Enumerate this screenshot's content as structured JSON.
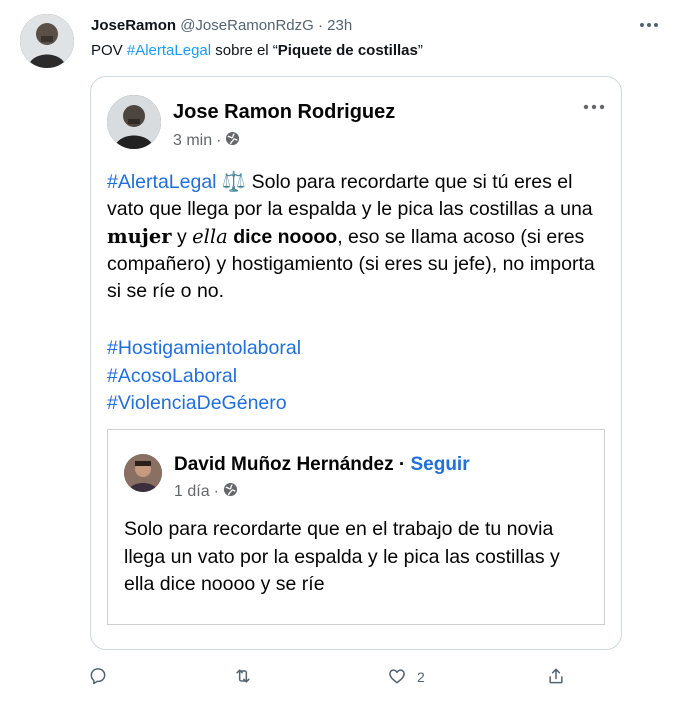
{
  "tweet": {
    "display_name": "JoseRamon",
    "handle": "@JoseRamonRdzG",
    "separator": "·",
    "time": "23h",
    "text_prefix": "POV ",
    "hashtag": "#AlertaLegal",
    "text_middle": " sobre el ",
    "quote_open": "“",
    "bold_phrase": "Piquete de costillas",
    "quote_close": "”"
  },
  "facebook_post": {
    "author": "Jose Ramon Rodriguez",
    "time": "3 min",
    "separator": "·",
    "hashtag": "#AlertaLegal",
    "emoji": "⚖️",
    "text_1": " Solo para recordarte que si tú eres el vato que llega por la espalda y le pica las costillas a una ",
    "word_mujer": "mujer",
    "text_2": " y ",
    "word_ella": "ella",
    "word_dice": " dice noooo",
    "text_3": ", eso se llama acoso (si eres compañero) y hostigamiento (si eres su jefe), no importa si se ríe o no.",
    "hashtags": [
      "#Hostigamientolaboral",
      "#AcosoLaboral",
      "#ViolenciaDeGénero"
    ]
  },
  "shared_post": {
    "author": "David Muñoz Hernández",
    "separator": "·",
    "follow_label": "Seguir",
    "time": "1 día",
    "text": "Solo para recordarte que en el trabajo de tu novia llega un vato por la espalda y le pica las costillas y ella dice noooo y se ríe"
  },
  "actions": {
    "reply_count": "",
    "retweet_count": "",
    "like_count": "2"
  },
  "colors": {
    "twitter_blue": "#1d9bf0",
    "facebook_blue": "#216fdb",
    "muted": "#536471"
  }
}
